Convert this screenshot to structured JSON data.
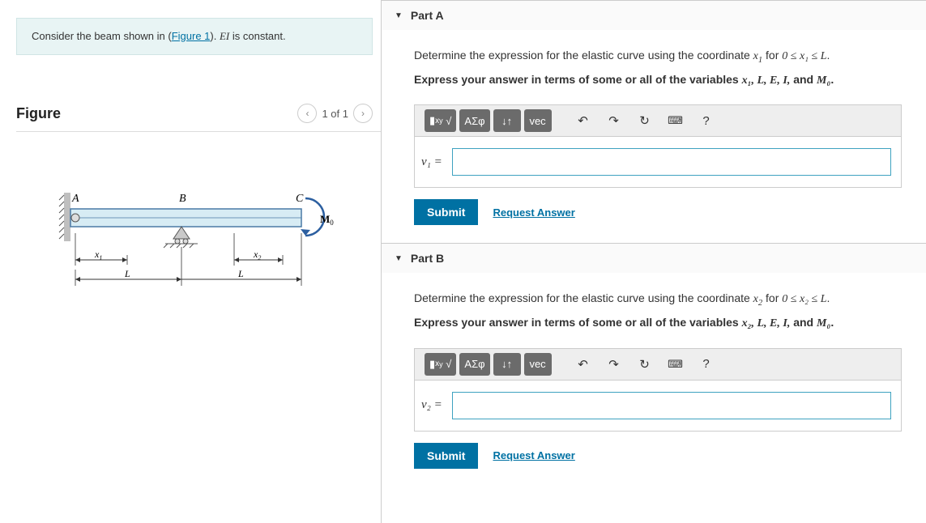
{
  "intro": {
    "prefix": "Consider the beam shown in (",
    "link": "Figure 1",
    "suffix_a": "). ",
    "ei": "EI",
    "suffix_b": " is constant."
  },
  "figure": {
    "title": "Figure",
    "counter": "1 of 1",
    "labels": {
      "A": "A",
      "B": "B",
      "C": "C",
      "M0": "M",
      "M0_sub": "0",
      "x1": "x",
      "x1_sub": "1",
      "x2": "x",
      "x2_sub": "2",
      "L": "L"
    }
  },
  "parts": {
    "A": {
      "title": "Part A",
      "prompt_prefix": "Determine the expression for the elastic curve using the coordinate ",
      "coord": "x",
      "coord_sub": "1",
      "range_prefix": " for ",
      "range": "0 ≤ x₁ ≤ L",
      "range_suffix": ".",
      "express": "Express your answer in terms of some or all of the variables ",
      "vars": "x₁, L, E, I,",
      "and": " and ",
      "M0": "M₀",
      "period": ".",
      "var_label": "v₁ =",
      "submit": "Submit",
      "request": "Request Answer"
    },
    "B": {
      "title": "Part B",
      "prompt_prefix": "Determine the expression for the elastic curve using the coordinate ",
      "coord": "x",
      "coord_sub": "2",
      "range_prefix": " for ",
      "range": "0 ≤ x₂ ≤ L",
      "range_suffix": ".",
      "express": "Express your answer in terms of some or all of the variables ",
      "vars": "x₂, L, E, I,",
      "and": " and ",
      "M0": "M₀",
      "period": ".",
      "var_label": "v₂ =",
      "submit": "Submit",
      "request": "Request Answer"
    }
  },
  "toolbar": {
    "templates": "▮",
    "sqrt": "√",
    "greek": "ΑΣφ",
    "updown": "↓↑",
    "vec": "vec",
    "undo": "↶",
    "redo": "↷",
    "reset": "↻",
    "keyboard": "⌨",
    "help": "?"
  }
}
